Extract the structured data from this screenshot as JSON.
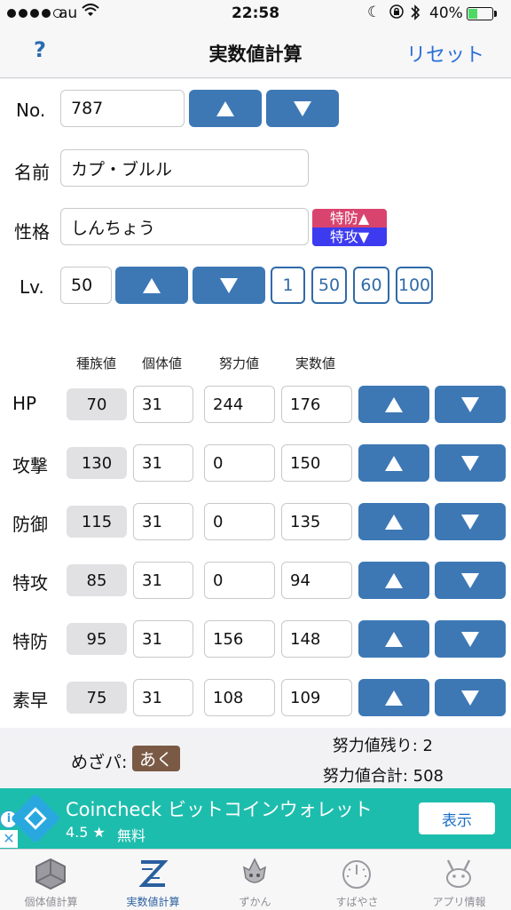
{
  "status": {
    "carrier": "au",
    "time": "22:58",
    "battery": "40%",
    "battery_level": 0.4
  },
  "nav": {
    "help": "?",
    "title": "実数値計算",
    "reset": "リセット"
  },
  "form": {
    "no_label": "No.",
    "no_value": "787",
    "name_label": "名前",
    "name_value": "カプ・ブルル",
    "nature_label": "性格",
    "nature_value": "しんちょう",
    "nature_up": "特防▲",
    "nature_down": "特攻▼",
    "lv_label": "Lv.",
    "lv_value": "50",
    "lv_quick": [
      "1",
      "50",
      "60",
      "100"
    ]
  },
  "columns": {
    "base": "種族値",
    "iv": "個体値",
    "ev": "努力値",
    "actual": "実数値"
  },
  "stats": [
    {
      "name": "HP",
      "base": "70",
      "iv": "31",
      "ev": "244",
      "actual": "176"
    },
    {
      "name": "攻撃",
      "base": "130",
      "iv": "31",
      "ev": "0",
      "actual": "150"
    },
    {
      "name": "防御",
      "base": "115",
      "iv": "31",
      "ev": "0",
      "actual": "135"
    },
    {
      "name": "特攻",
      "base": "85",
      "iv": "31",
      "ev": "0",
      "actual": "94"
    },
    {
      "name": "特防",
      "base": "95",
      "iv": "31",
      "ev": "156",
      "actual": "148"
    },
    {
      "name": "素早",
      "base": "75",
      "iv": "31",
      "ev": "108",
      "actual": "109"
    }
  ],
  "summary": {
    "mezapa_label": "めざパ:",
    "mezapa_type": "あく",
    "ev_remaining": "努力値残り: 2",
    "ev_total": "努力値合計: 508"
  },
  "ad": {
    "title": "Coincheck ビットコインウォレット",
    "rating": "4.5 ★",
    "price": "無料",
    "cta": "表示"
  },
  "tabs": [
    {
      "label": "個体値計算",
      "icon": "hexagon-icon"
    },
    {
      "label": "実数値計算",
      "icon": "z-calc-icon"
    },
    {
      "label": "ずかん",
      "icon": "pokedex-icon"
    },
    {
      "label": "すばやさ",
      "icon": "speedometer-icon"
    },
    {
      "label": "アプリ情報",
      "icon": "pikachu-icon"
    }
  ],
  "colors": {
    "accent_button": "#3d78b5",
    "nature_up": "#d9446e",
    "nature_down": "#3d3bf0",
    "ad_background": "#1dbdad",
    "type_dark": "#7a5a45"
  }
}
